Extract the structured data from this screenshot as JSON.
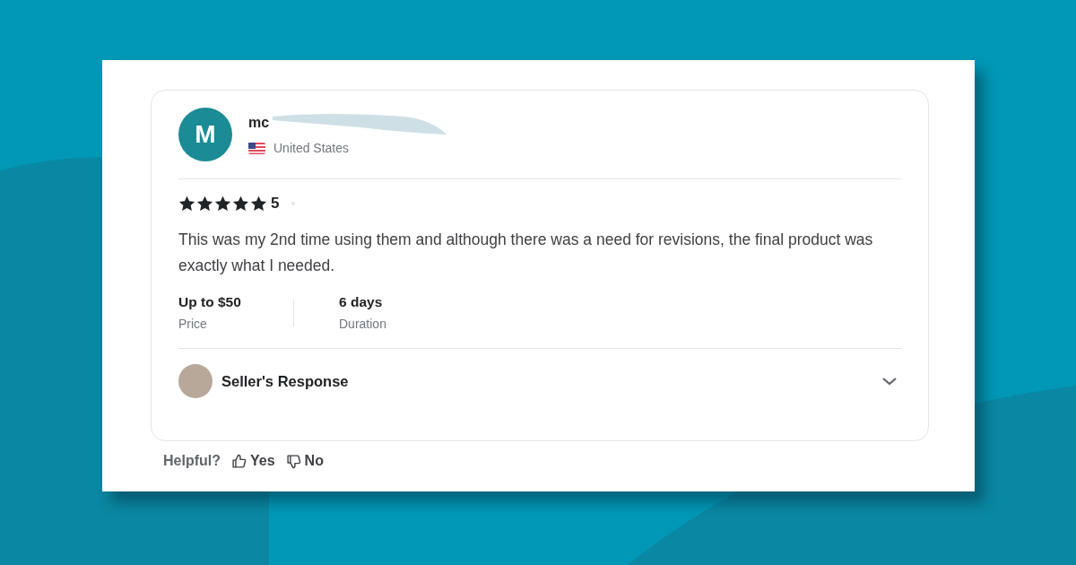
{
  "review": {
    "avatar_letter": "M",
    "username": "mc",
    "country": "United States",
    "stars": 5,
    "rating": "5",
    "text": "This was my 2nd time using them and although there was a need for revisions, the final product was exactly what I needed.",
    "details": [
      {
        "value": "Up to $50",
        "label": "Price"
      },
      {
        "value": "6 days",
        "label": "Duration"
      }
    ],
    "seller_response": {
      "title": "Seller's Response",
      "expanded": false
    }
  },
  "helpful": {
    "label": "Helpful?",
    "yes": "Yes",
    "no": "No"
  }
}
